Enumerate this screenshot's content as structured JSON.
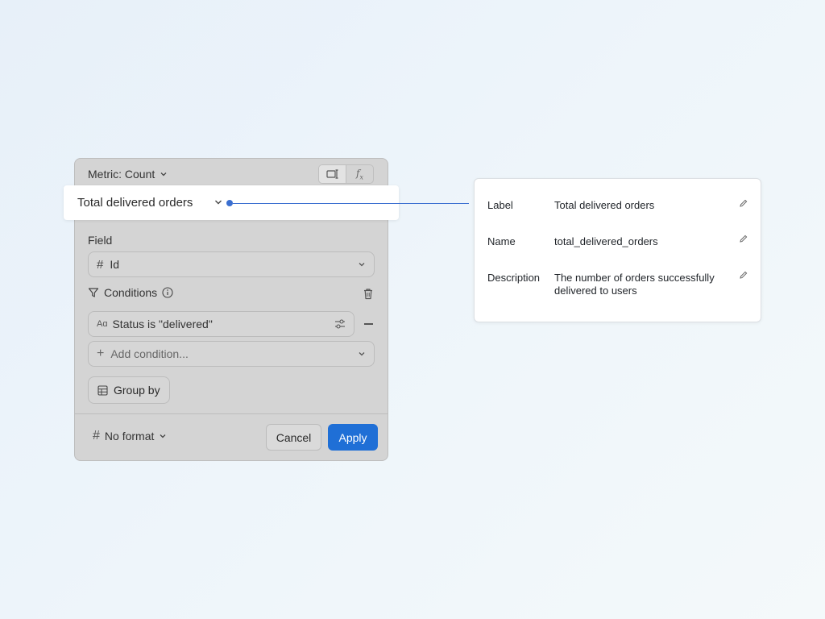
{
  "panel": {
    "metric_selector_label": "Metric: Count",
    "mode_icons": [
      "table-icon",
      "function-icon"
    ],
    "label_title": "Total delivered orders",
    "field_section_label": "Field",
    "field_value": "Id",
    "conditions_label": "Conditions",
    "conditions": [
      {
        "text": "Status is \"delivered\"",
        "type_icon_text": "Aɑ"
      }
    ],
    "add_condition_placeholder": "Add condition...",
    "group_by_label": "Group by",
    "format_label": "No format",
    "cancel_label": "Cancel",
    "apply_label": "Apply"
  },
  "details": {
    "label_key": "Label",
    "label_value": "Total delivered orders",
    "name_key": "Name",
    "name_value": "total_delivered_orders",
    "description_key": "Description",
    "description_value": "The number of orders successfully delivered to users"
  },
  "colors": {
    "accent": "#1f6fd6",
    "connector": "#3b6fd0",
    "panel_bg": "#d4d4d4"
  }
}
